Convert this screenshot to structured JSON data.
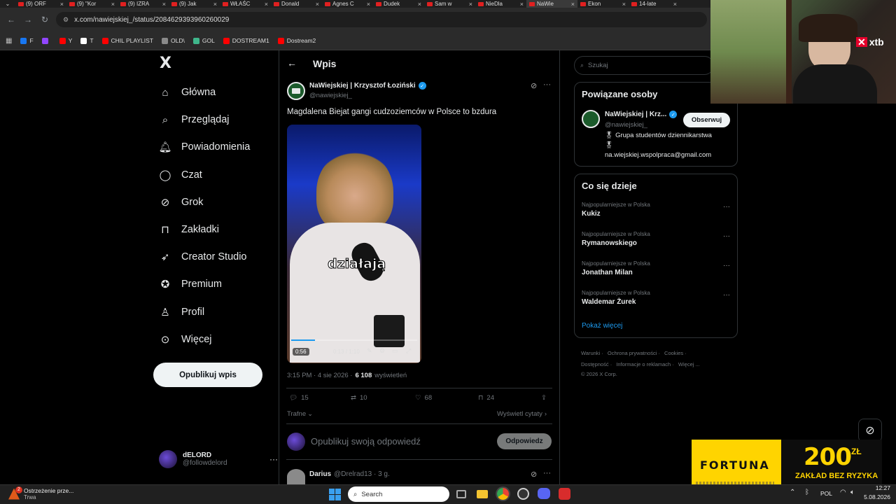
{
  "browser": {
    "tabs": [
      {
        "label": "(9) ORF"
      },
      {
        "label": "(9) \"Kor"
      },
      {
        "label": "(9) IZRA"
      },
      {
        "label": "(9) Jak"
      },
      {
        "label": "WŁAŚC"
      },
      {
        "label": "Donald"
      },
      {
        "label": "Agnes C"
      },
      {
        "label": "Dudek"
      },
      {
        "label": "Sam w"
      },
      {
        "label": "NieDla"
      },
      {
        "label": "NaWie"
      },
      {
        "label": "Ekon"
      },
      {
        "label": "14-late"
      }
    ],
    "active_tab_index": 10,
    "url": "x.com/nawiejskiej_/status/2084629393960260029",
    "bookmarks": [
      {
        "label": "F",
        "color": "#1877f2"
      },
      {
        "label": "",
        "color": "#9146ff"
      },
      {
        "label": "Y",
        "color": "#ff0000"
      },
      {
        "label": "T",
        "color": "#ffffff"
      },
      {
        "label": "CHIL PLAYLIST",
        "color": "#ff0000"
      },
      {
        "label": "OLD\\",
        "color": "#8a8a8a"
      },
      {
        "label": "GOL",
        "color": "#3fb68b"
      },
      {
        "label": "DOSTREAM1",
        "color": "#ff0000"
      },
      {
        "label": "Dostream2",
        "color": "#ff0000"
      }
    ]
  },
  "sidebar": {
    "logo": "X",
    "items": [
      {
        "label": "Główna",
        "icon": "home-icon"
      },
      {
        "label": "Przeglądaj",
        "icon": "search-icon"
      },
      {
        "label": "Powiadomienia",
        "icon": "bell-icon"
      },
      {
        "label": "Czat",
        "icon": "chat-icon"
      },
      {
        "label": "Grok",
        "icon": "grok-icon"
      },
      {
        "label": "Zakładki",
        "icon": "bookmark-icon"
      },
      {
        "label": "Creator Studio",
        "icon": "rocket-icon"
      },
      {
        "label": "Premium",
        "icon": "premium-icon"
      },
      {
        "label": "Profil",
        "icon": "person-icon"
      },
      {
        "label": "Więcej",
        "icon": "more-icon"
      }
    ],
    "post_button": "Opublikuj wpis",
    "account": {
      "name": "dELORD",
      "handle": "@followdelord"
    }
  },
  "post": {
    "header_title": "Wpis",
    "author_name": "NaWiejskiej | Krzysztof Łoziński",
    "author_handle": "@nawiejskiej_",
    "text": "Magdalena Biejat gangi cudzoziemców w Polsce to bzdura",
    "video": {
      "caption": "działają",
      "duration_badge": "0:56",
      "time": "0:13 / 1:10"
    },
    "meta_time": "3:15 PM · 4 sie 2026 ·",
    "views_count": "6 108",
    "views_label": "wyświetleń",
    "stats": {
      "replies": "15",
      "reposts": "10",
      "likes": "68",
      "bookmarks": "24"
    },
    "sort_label": "Trafne",
    "quotes_label": "Wyświetl cytaty",
    "reply_placeholder": "Opublikuj swoją odpowiedź",
    "reply_button": "Odpowiedz",
    "next_reply": {
      "name": "Darius",
      "handle": "@Drelrad13 · 3 g."
    }
  },
  "right": {
    "search_placeholder": "Szukaj",
    "related": {
      "title": "Powiązane osoby",
      "name": "NaWiejskiej | Krz...",
      "handle": "@nawiejskiej_",
      "follow": "Obserwuj",
      "bio1": "Grupa studentów dziennikarstwa",
      "bio2": "na.wiejskiej.wspolpraca@gmail.com"
    },
    "trends": {
      "title": "Co się dzieje",
      "items": [
        {
          "context": "Najpopularniejsze w Polska",
          "topic": "Kukiz"
        },
        {
          "context": "Najpopularniejsze w Polska",
          "topic": "Rymanowskiego"
        },
        {
          "context": "Najpopularniejsze w Polska",
          "topic": "Jonathan Milan"
        },
        {
          "context": "Najpopularniejsze w Polska",
          "topic": "Waldemar Żurek"
        }
      ],
      "show_more": "Pokaż więcej"
    },
    "footer": {
      "l1a": "Warunki",
      "l1b": "Ochrona prywatności",
      "l1c": "Cookies",
      "l2a": "Dostępność",
      "l2b": "Informacje o reklamach",
      "l2c": "Więcej ...",
      "l3": "© 2026 X Corp."
    }
  },
  "overlay": {
    "brand": "xtb",
    "ad_brand": "FORTUNA",
    "ad_amount": "200",
    "ad_currency": "ZŁ",
    "ad_tagline": "ZAKŁAD BEZ RYZYKA"
  },
  "taskbar": {
    "notification_title": "Ostrzeżenie prze...",
    "notification_sub": "Trwa",
    "notification_badge": "2",
    "search_label": "Search",
    "lang": "POL",
    "time": "12:27",
    "date": "5.08.2026"
  },
  "colors": {
    "accent": "#1d9bf0",
    "verified": "#1d9bf0",
    "border": "#2f3336",
    "muted": "#71767b",
    "ad_yellow": "#ffd400"
  }
}
